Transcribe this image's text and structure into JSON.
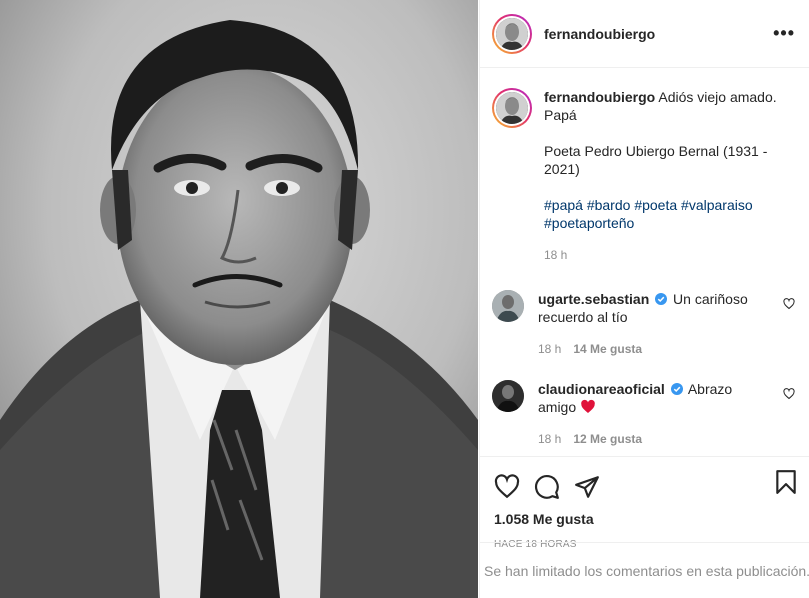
{
  "post": {
    "author": "fernandoubiergo",
    "more_label": "•••",
    "photo_alt": "Retrato en blanco y negro"
  },
  "caption": {
    "username": "fernandoubiergo",
    "line1": "Adiós viejo amado.",
    "line2": "Papá",
    "line3": "Poeta Pedro Ubiergo Bernal (1931 -",
    "line4": "2021)",
    "hashtags_line1": [
      "#papá",
      "#bardo",
      "#poeta",
      "#valparaiso"
    ],
    "hashtags_line2": [
      "#poetaporteño"
    ],
    "time": "18 h"
  },
  "comments": [
    {
      "username": "ugarte.sebastian",
      "text_line1": "Un cariñoso",
      "text_line2": "recuerdo al tío",
      "time": "18 h",
      "likes": "14 Me gusta"
    },
    {
      "username": "claudionareaoficial",
      "text_line1": "Abrazo",
      "text_line2": "amigo",
      "time": "18 h",
      "likes": "12 Me gusta"
    }
  ],
  "actions": {
    "like_icon": "heart-icon",
    "comment_icon": "comment-icon",
    "share_icon": "paper-plane-icon",
    "save_icon": "bookmark-icon",
    "likes_count": "1.058 Me gusta",
    "posted": "HACE 18 HORAS"
  },
  "footer": {
    "notice": "Se han limitado los comentarios en esta publicación."
  },
  "colors": {
    "hashtag": "#00376b",
    "verified": "#3897f0",
    "muted": "#8e8e8e",
    "heart_emoji": "#e0123a"
  }
}
